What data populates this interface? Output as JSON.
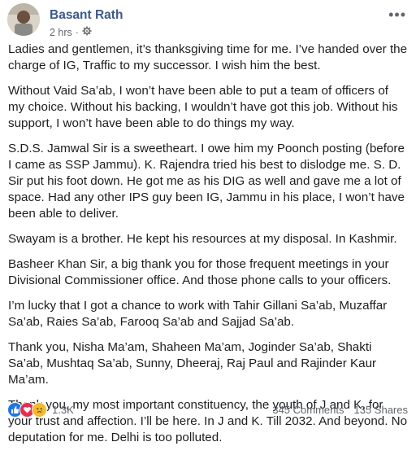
{
  "post": {
    "author": "Basant Rath",
    "timestamp": "2 hrs",
    "audience_icon": "gear-icon",
    "paragraphs": [
      "Ladies and gentlemen, it’s thanksgiving time for me. I’ve handed over the charge of IG, Traffic to my successor. I wish him the best.",
      "Without Vaid Sa’ab, I won’t have been able to put a team of officers of my choice. Without his backing, I wouldn’t have got this job. Without his support, I won’t have been able to do things my way.",
      "S.D.S. Jamwal Sir is a sweetheart. I owe him my Poonch posting (before I came as SSP Jammu). K. Rajendra tried his best to dislodge me. S. D. Sir put his foot down. He got me as his DIG as well and gave me a lot of space. Had any other IPS guy been IG, Jammu in his place, I won’t have been able to deliver.",
      "Swayam is a brother. He kept his resources at my disposal. In Kashmir.",
      "Basheer Khan Sir, a big thank you for those frequent meetings in your Divisional Commissioner office. And those phone calls to your officers.",
      "I’m lucky that I got a chance to work with Tahir Gillani Sa’ab, Muzaffar Sa’ab, Raies Sa’ab, Farooq Sa’ab and Sajjad Sa’ab.",
      "Thank you, Nisha Ma’am, Shaheen Ma’am, Joginder Sa’ab, Shakti Sa’ab, Mushtaq Sa’ab, Sunny, Dheeraj, Raj Paul and Rajinder Kaur Ma’am.",
      "Thank you, my most important constituency, the youth of J and K, for your trust and affection. I’ll be here. In J and K. Till 2032. And beyond. No deputation for me. Delhi is too polluted."
    ]
  },
  "footer": {
    "reaction_icons": [
      "like-icon",
      "love-icon",
      "sad-icon"
    ],
    "reaction_count": "1.3K",
    "comments": "345 Comments",
    "shares": "135 Shares"
  },
  "colors": {
    "author_link": "#385898",
    "meta_text": "#616770",
    "body_text": "#1c1e21",
    "like": "#1877f2",
    "love": "#f0284a",
    "sad": "#f7b928"
  }
}
